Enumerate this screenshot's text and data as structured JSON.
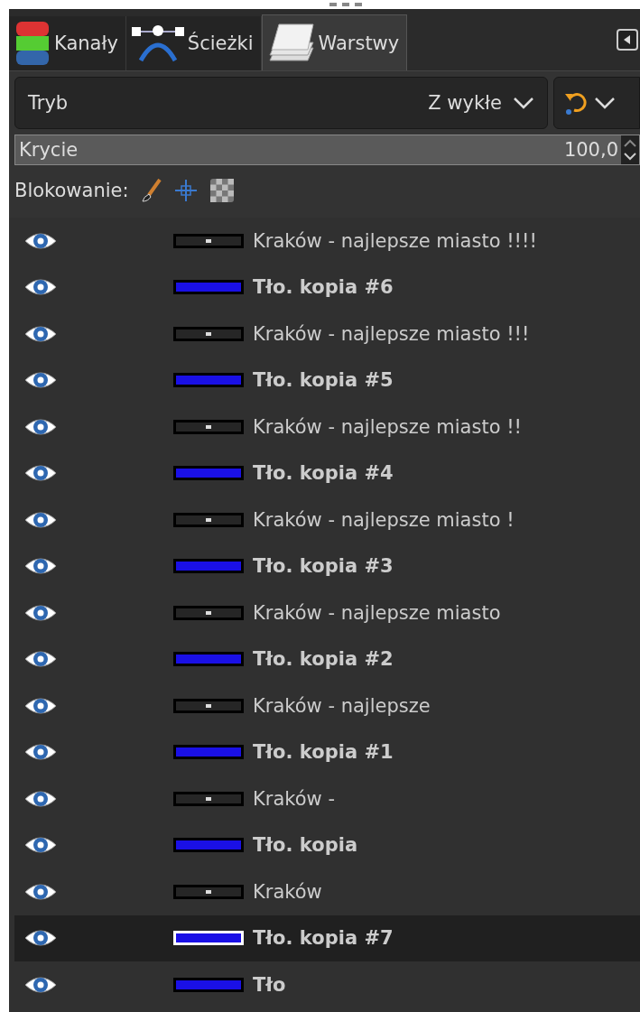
{
  "tabs": [
    {
      "label": "Kanały",
      "kind": "channels",
      "selected": false
    },
    {
      "label": "Ścieżki",
      "kind": "paths",
      "selected": false
    },
    {
      "label": "Warstwy",
      "kind": "layers",
      "selected": true
    }
  ],
  "mode": {
    "label": "Tryb",
    "value": "Z wykłe"
  },
  "opacity": {
    "label": "Krycie",
    "value": "100,0"
  },
  "lock": {
    "label": "Blokowanie:"
  },
  "layers": [
    {
      "name": "Kraków - najlepsze miasto !!!!",
      "kind": "text",
      "visible": true,
      "selected": false
    },
    {
      "name": "Tło. kopia #6",
      "kind": "image",
      "visible": true,
      "selected": false
    },
    {
      "name": "Kraków - najlepsze miasto !!!",
      "kind": "text",
      "visible": true,
      "selected": false
    },
    {
      "name": "Tło. kopia #5",
      "kind": "image",
      "visible": true,
      "selected": false
    },
    {
      "name": "Kraków - najlepsze miasto !!",
      "kind": "text",
      "visible": true,
      "selected": false
    },
    {
      "name": "Tło. kopia #4",
      "kind": "image",
      "visible": true,
      "selected": false
    },
    {
      "name": "Kraków - najlepsze miasto !",
      "kind": "text",
      "visible": true,
      "selected": false
    },
    {
      "name": "Tło. kopia #3",
      "kind": "image",
      "visible": true,
      "selected": false
    },
    {
      "name": "Kraków - najlepsze miasto",
      "kind": "text",
      "visible": true,
      "selected": false
    },
    {
      "name": "Tło. kopia #2",
      "kind": "image",
      "visible": true,
      "selected": false
    },
    {
      "name": "Kraków - najlepsze",
      "kind": "text",
      "visible": true,
      "selected": false
    },
    {
      "name": "Tło. kopia #1",
      "kind": "image",
      "visible": true,
      "selected": false
    },
    {
      "name": "Kraków -",
      "kind": "text",
      "visible": true,
      "selected": false
    },
    {
      "name": "Tło. kopia",
      "kind": "image",
      "visible": true,
      "selected": false
    },
    {
      "name": "Kraków",
      "kind": "text",
      "visible": true,
      "selected": false
    },
    {
      "name": "Tło. kopia #7",
      "kind": "image",
      "visible": true,
      "selected": true
    },
    {
      "name": "Tło",
      "kind": "image",
      "visible": true,
      "selected": false
    }
  ]
}
